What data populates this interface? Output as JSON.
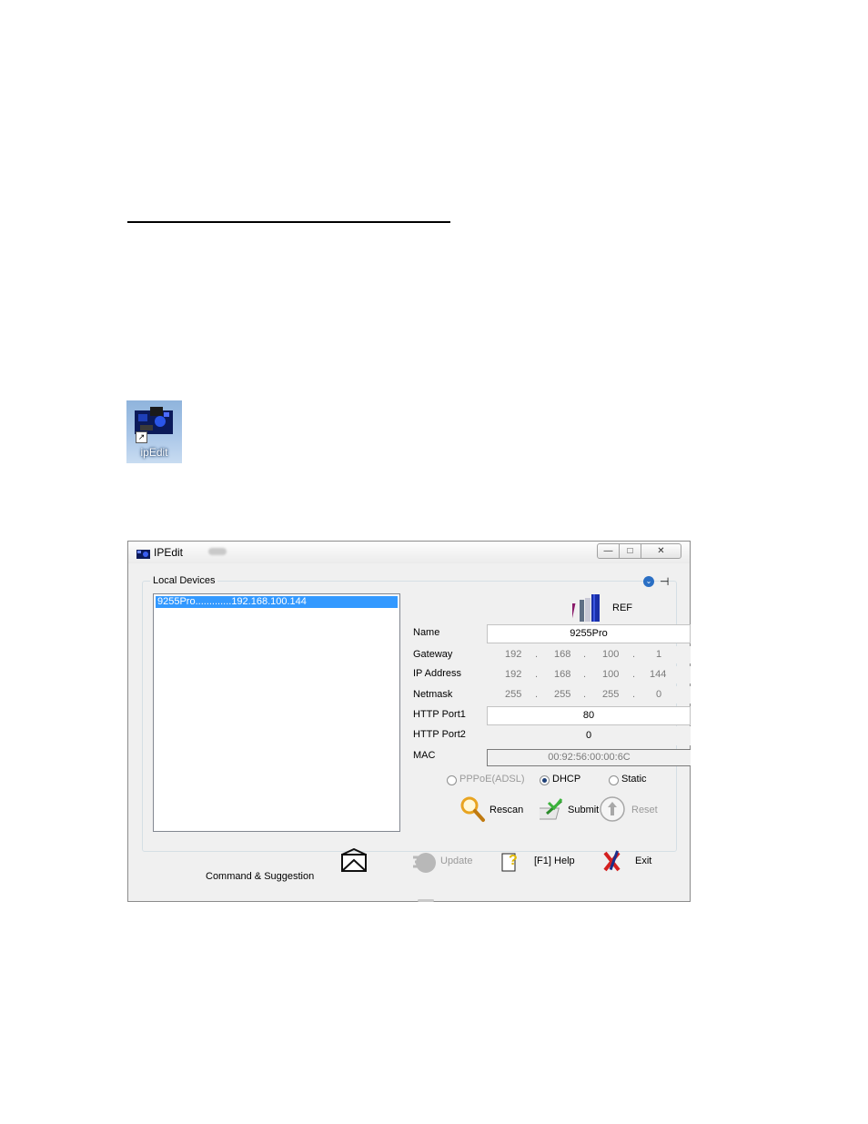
{
  "desktop_icon": {
    "label": "ipEdit"
  },
  "window": {
    "title": "IPEdit",
    "controls": {
      "minimize": "—",
      "maximize": "□",
      "close": "✕"
    },
    "group_label": "Local Devices",
    "device_list": [
      {
        "label": "9255Pro.............192.168.100.144",
        "selected": true
      }
    ],
    "ref_label": "REF",
    "fields": {
      "name": {
        "label": "Name",
        "value": "9255Pro"
      },
      "gateway": {
        "label": "Gateway",
        "octets": [
          "192",
          "168",
          "100",
          "1"
        ]
      },
      "ip_address": {
        "label": "IP Address",
        "octets": [
          "192",
          "168",
          "100",
          "144"
        ]
      },
      "netmask": {
        "label": "Netmask",
        "octets": [
          "255",
          "255",
          "255",
          "0"
        ]
      },
      "http_port1": {
        "label": "HTTP Port1",
        "value": "80"
      },
      "http_port2": {
        "label": "HTTP Port2",
        "value": "0"
      },
      "mac": {
        "label": "MAC",
        "value": "00:92:56:00:00:6C"
      }
    },
    "octet_separator": ".",
    "radios": [
      {
        "label": "PPPoE(ADSL)",
        "selected": false,
        "disabled": true
      },
      {
        "label": "DHCP",
        "selected": true,
        "disabled": false
      },
      {
        "label": "Static",
        "selected": false,
        "disabled": false
      }
    ],
    "actions": {
      "rescan": "Rescan",
      "submit": "Submit",
      "reset": "Reset"
    },
    "bottom": {
      "update": "Update",
      "help": "[F1] Help",
      "exit": "Exit",
      "command_suggestion": "Command & Suggestion"
    },
    "icons": {
      "chevron": "⌄",
      "pin": "⊣"
    }
  }
}
